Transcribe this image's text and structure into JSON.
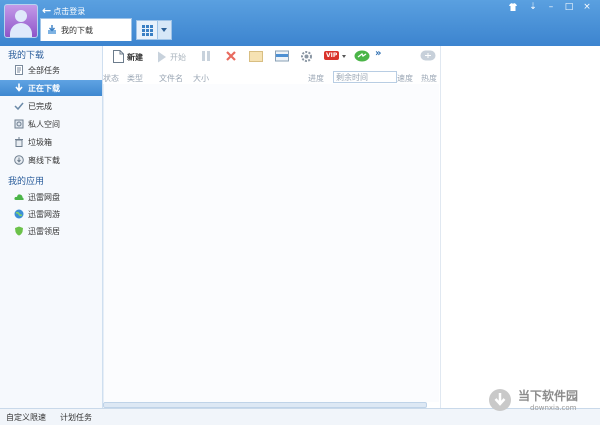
{
  "header": {
    "login_text": "点击登录",
    "active_tab": "我的下载"
  },
  "sidebar": {
    "section1": "我的下载",
    "downloads": [
      {
        "label": "全部任务",
        "icon": "document-icon"
      },
      {
        "label": "正在下载",
        "icon": "download-arrow-icon",
        "active": true
      },
      {
        "label": "已完成",
        "icon": "checkmark-icon"
      },
      {
        "label": "私人空间",
        "icon": "safe-icon"
      },
      {
        "label": "垃圾箱",
        "icon": "trash-icon"
      },
      {
        "label": "离线下载",
        "icon": "cloud-download-icon"
      }
    ],
    "section2": "我的应用",
    "apps": [
      {
        "label": "迅雷网盘",
        "icon": "cloud-drive-icon"
      },
      {
        "label": "迅雷网游",
        "icon": "globe-icon"
      },
      {
        "label": "迅雷领居",
        "icon": "shield-icon"
      }
    ]
  },
  "toolbar": {
    "new_label": "新建",
    "start_label": "开始",
    "vip_label": "VIP"
  },
  "columns": {
    "status": "状态",
    "type": "类型",
    "filename": "文件名",
    "size": "大小",
    "progress": "进度",
    "remaining": "剩余时间",
    "speed": "速度",
    "heat": "热度"
  },
  "statusbar": {
    "custom_speed": "自定义限速",
    "schedule": "计划任务"
  },
  "watermark": {
    "title": "当下软件园",
    "url": "downxia.com"
  },
  "colors": {
    "titlebar": "#3c84cf",
    "active_item": "#4a92d8",
    "accent_red": "#e04040"
  }
}
